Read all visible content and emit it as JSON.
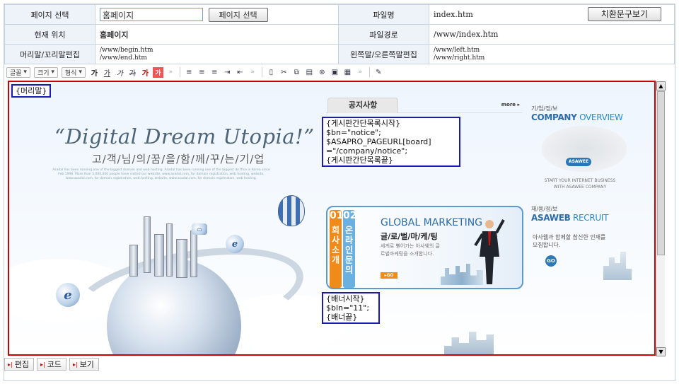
{
  "info": {
    "row1": {
      "label": "페이지 선택",
      "select_value": "홈페이지",
      "button": "페이지 선택",
      "label2": "파일명",
      "value2": "index.htm",
      "button2": "치환문구보기"
    },
    "row2": {
      "label": "현재 위치",
      "value": "홈페이지",
      "label2": "파일경로",
      "value2": "/www/index.htm"
    },
    "row3": {
      "label": "머리말/꼬리말편집",
      "value_a": "/www/begin.htm",
      "value_b": "/www/end.htm",
      "label2": "왼쪽말/오른쪽말편집",
      "value2_a": "/www/left.htm",
      "value2_b": "/www/right.htm"
    }
  },
  "toolbar": {
    "font": "글꼴",
    "size": "크기",
    "format": "형식",
    "buttons": [
      {
        "name": "bold-button",
        "glyph": "가"
      },
      {
        "name": "underline-button",
        "glyph": "가"
      },
      {
        "name": "italic-button",
        "glyph": "가"
      },
      {
        "name": "strike-button",
        "glyph": "가"
      },
      {
        "name": "font-color-button",
        "glyph": "가"
      },
      {
        "name": "bg-color-button",
        "glyph": "가"
      },
      {
        "name": "more-button",
        "glyph": "»"
      }
    ]
  },
  "editor": {
    "header_tag": "{머리말}",
    "board_tag": [
      "{게시판간단목록시작}",
      "$bn=\"notice\";",
      "$ASAPRO_PAGEURL[board]",
      "=\"/company/notice\";",
      "{게시판간단목록끝}"
    ],
    "banner_tag": [
      "{배너시작}",
      "$bln=\"11\";",
      "{배너끝}"
    ],
    "headline": "“Digital Dream Utopia!”",
    "subhead": "고/객/님/의/꿈/을/함/께/꾸/는/기/업",
    "fine_print": "Asadal has been running one of the biggest domain and web hosting. Asadal has been running one of the biggest do ffice in Korea since Feb 1998. More than 5,000,000 people have visited our website, www.asadal.com, for domain registration, web hosting, website, www.asadal.com, for domain registration, web hosting, website, www.asadal.com, for domain registration, web hosting.",
    "notice_tab": "공지사항",
    "more": "more ▸",
    "banner": {
      "num1": "01",
      "num1_label": "회사소개",
      "num2": "02",
      "num2_label": "온라인문의",
      "title": "GLOBAL MARKETING",
      "subtitle": "글/로/벌/마/케/팅",
      "desc": "세계로 뻗어가는 아사웨의 글로벌마케팅을 소개합니다.",
      "go": "▸GO"
    },
    "side1": {
      "kicker": "기/업/정/보",
      "title_a": "COMPANY",
      "title_b": " OVERVIEW",
      "pill": "ASAWEE",
      "tag1": "START YOUR INTERNET BUSINESS",
      "tag2": "WITH ASAWEE COMPANY"
    },
    "side2": {
      "kicker": "채/용/정/보",
      "title_a": "ASAWEB",
      "title_b": " RECRUIT",
      "desc": "아사웹과 함께할 참신한 인재를 모집합니다.",
      "go": "GO"
    }
  },
  "bottom_tabs": [
    "편집",
    "코드",
    "보기"
  ]
}
